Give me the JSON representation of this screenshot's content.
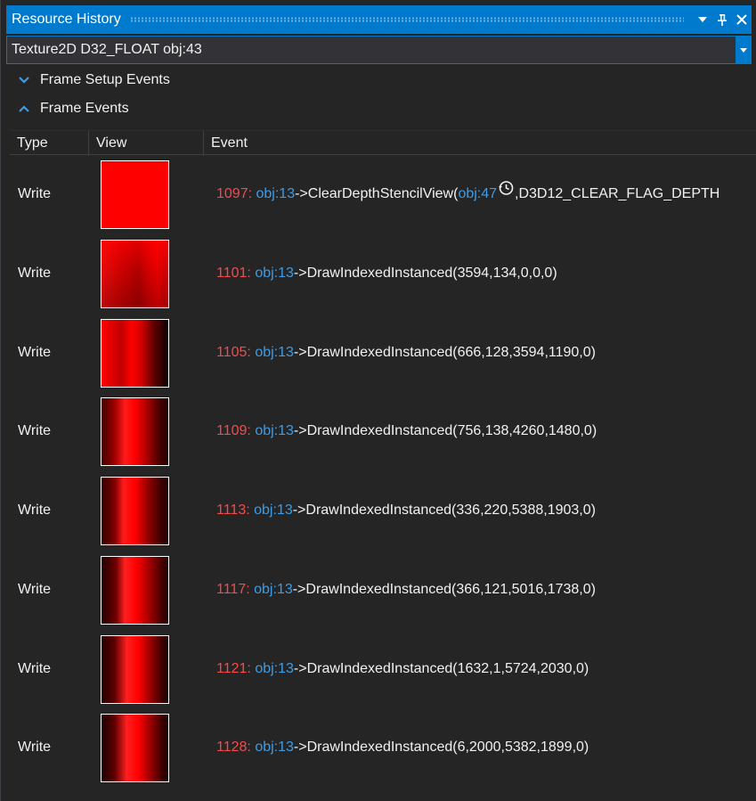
{
  "window": {
    "title": "Resource History",
    "dropdown_icon": "caret-down-icon",
    "pin_icon": "pin-icon",
    "close_icon": "close-icon"
  },
  "resource_select": {
    "value": "Texture2D D32_FLOAT obj:43"
  },
  "sections": [
    {
      "label": "Frame Setup Events",
      "state": "collapsed"
    },
    {
      "label": "Frame Events",
      "state": "expanded"
    }
  ],
  "columns": [
    "Type",
    "View",
    "Event"
  ],
  "rows": [
    {
      "type": "Write",
      "num": "1097:",
      "obj": "obj:13",
      "call": "->ClearDepthStencilView(",
      "arg_obj": "obj:47",
      "rest": ",D3D12_CLEAR_FLAG_DEPTH",
      "has_clock": true,
      "thumb": "solid"
    },
    {
      "type": "Write",
      "num": "1101:",
      "obj": "obj:13",
      "call": "->DrawIndexedInstanced(3594,134,0,0,0)",
      "arg_obj": "",
      "rest": "",
      "has_clock": false,
      "thumb": "a"
    },
    {
      "type": "Write",
      "num": "1105:",
      "obj": "obj:13",
      "call": "->DrawIndexedInstanced(666,128,3594,1190,0)",
      "arg_obj": "",
      "rest": "",
      "has_clock": false,
      "thumb": "b"
    },
    {
      "type": "Write",
      "num": "1109:",
      "obj": "obj:13",
      "call": "->DrawIndexedInstanced(756,138,4260,1480,0)",
      "arg_obj": "",
      "rest": "",
      "has_clock": false,
      "thumb": "c"
    },
    {
      "type": "Write",
      "num": "1113:",
      "obj": "obj:13",
      "call": "->DrawIndexedInstanced(336,220,5388,1903,0)",
      "arg_obj": "",
      "rest": "",
      "has_clock": false,
      "thumb": "d"
    },
    {
      "type": "Write",
      "num": "1117:",
      "obj": "obj:13",
      "call": "->DrawIndexedInstanced(366,121,5016,1738,0)",
      "arg_obj": "",
      "rest": "",
      "has_clock": false,
      "thumb": "e"
    },
    {
      "type": "Write",
      "num": "1121:",
      "obj": "obj:13",
      "call": "->DrawIndexedInstanced(1632,1,5724,2030,0)",
      "arg_obj": "",
      "rest": "",
      "has_clock": false,
      "thumb": "f"
    },
    {
      "type": "Write",
      "num": "1128:",
      "obj": "obj:13",
      "call": "->DrawIndexedInstanced(6,2000,5382,1899,0)",
      "arg_obj": "",
      "rest": "",
      "has_clock": false,
      "thumb": "g"
    }
  ],
  "colors": {
    "accent": "#007acc",
    "event_number": "#f14c4c",
    "object_link": "#3e9ce4",
    "background": "#252526"
  }
}
